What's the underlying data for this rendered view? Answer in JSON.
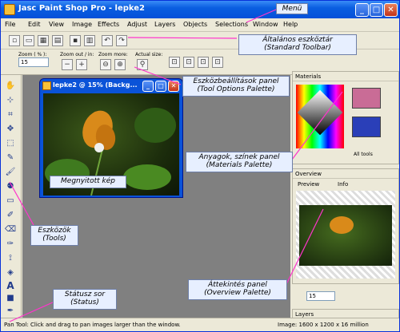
{
  "window": {
    "title": "Jasc Paint Shop Pro - lepke2"
  },
  "menu": [
    "File",
    "Edit",
    "View",
    "Image",
    "Effects",
    "Adjust",
    "Layers",
    "Objects",
    "Selections",
    "Window",
    "Help"
  ],
  "tool_options": {
    "zoom_label": "Zoom ( % ):",
    "zoom_value": "15",
    "zoom_inout_label": "Zoom out / in:",
    "zoom_more_label": "Zoom more:",
    "actual_size_label": "Actual size:"
  },
  "image_window": {
    "title": "lepke2 @ 15% (Backg..."
  },
  "materials": {
    "title": "Materials",
    "all_tools_label": "All tools",
    "foreground_color": "#c96c96",
    "background_color": "#2a3fb8"
  },
  "overview": {
    "title": "Overview",
    "tab_preview": "Preview",
    "tab_info": "Info",
    "zoom_value": "15"
  },
  "layers": {
    "title": "Layers"
  },
  "status": {
    "left": "Pan Tool: Click and drag to pan images larger than the window.",
    "right": "Image:  1600 x 1200 x 16 million"
  },
  "callouts": {
    "menu": "Menü",
    "toolbar_hu": "Általános eszköztár",
    "toolbar_en": "(Standard Toolbar)",
    "tooloptions_hu": "Eszközbeállítások panel",
    "tooloptions_en": "(Tool Options Palette)",
    "materials_hu": "Anyagok, színek panel",
    "materials_en": "(Materials Palette)",
    "image": "Megnyitott kép",
    "tools_hu": "Eszközök",
    "tools_en": "(Tools)",
    "overview_hu": "Áttekintés panel",
    "overview_en": "(Overview Palette)",
    "status_hu": "Státusz sor",
    "status_en": "(Status)"
  }
}
